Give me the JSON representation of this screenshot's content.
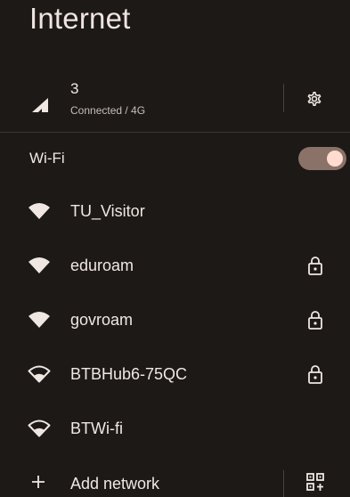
{
  "header": {
    "title": "Internet"
  },
  "mobile": {
    "carrier": "3",
    "status": "Connected / 4G",
    "signal_icon": "cellular-signal-icon",
    "settings_icon": "gear-icon"
  },
  "wifi": {
    "label": "Wi-Fi",
    "enabled": true,
    "networks": [
      {
        "name": "TU_Visitor",
        "signal": "full",
        "secured": false
      },
      {
        "name": "eduroam",
        "signal": "full",
        "secured": true
      },
      {
        "name": "govroam",
        "signal": "full",
        "secured": true
      },
      {
        "name": "BTBHub6-75QC",
        "signal": "outline",
        "secured": true
      },
      {
        "name": "BTWi-fi",
        "signal": "outline",
        "secured": false
      }
    ]
  },
  "add_network": {
    "label": "Add network",
    "qr_icon": "qr-code-scan-icon"
  },
  "colors": {
    "background": "#1c1917",
    "text": "#f1e7e2",
    "toggle_track": "#8a7268",
    "toggle_knob": "#ffdccf"
  }
}
